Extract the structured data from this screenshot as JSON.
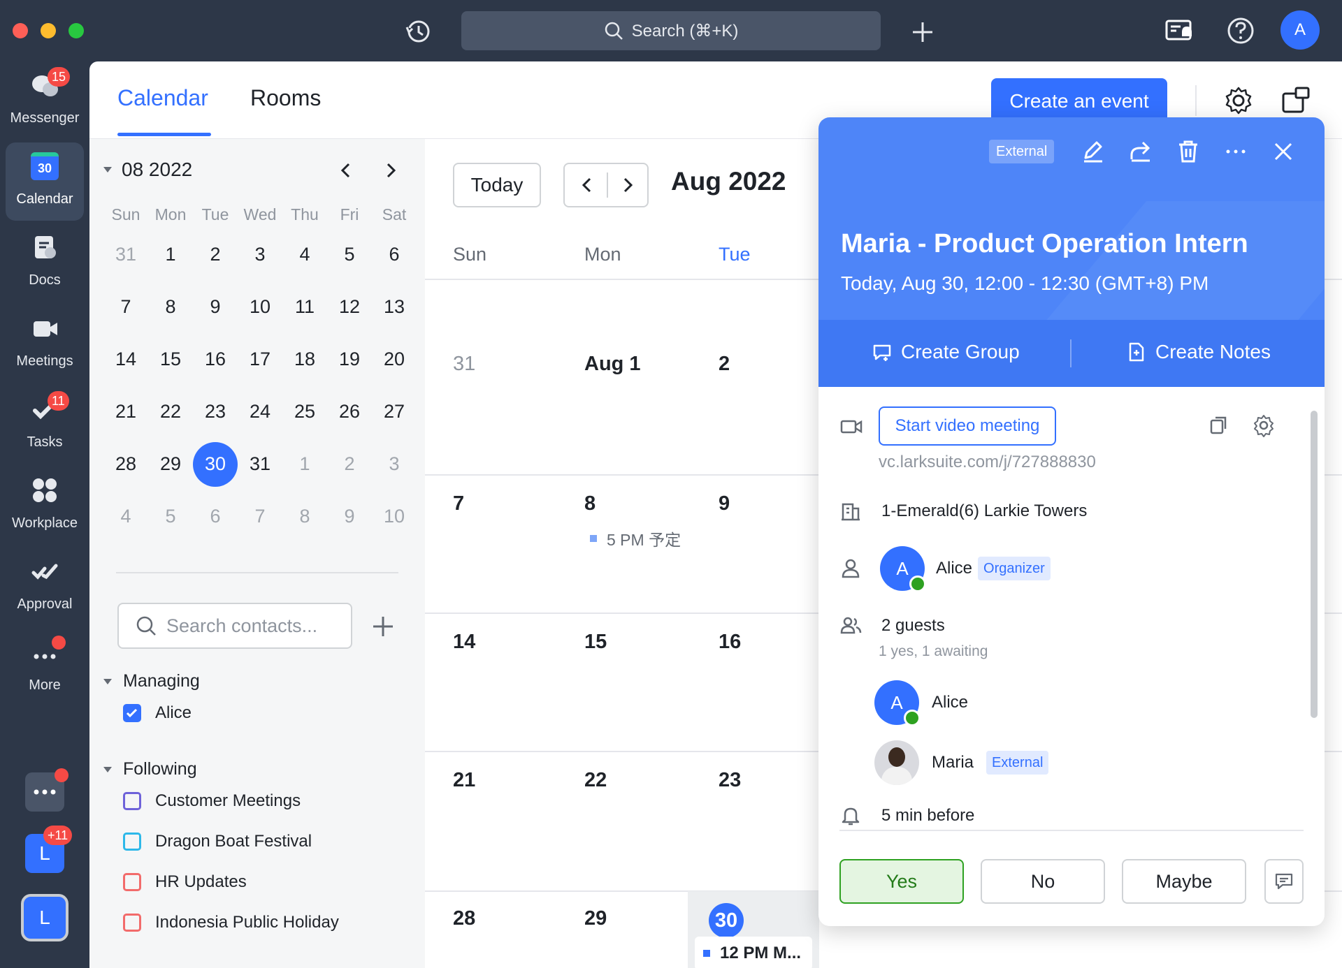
{
  "titlebar": {
    "search_label": "Search (⌘+K)",
    "avatar_initial": "A"
  },
  "nav": {
    "messenger": {
      "label": "Messenger",
      "badge": "15"
    },
    "calendar": {
      "label": "Calendar",
      "icon_day": "30"
    },
    "docs": {
      "label": "Docs"
    },
    "meetings": {
      "label": "Meetings"
    },
    "tasks": {
      "label": "Tasks",
      "badge": "11"
    },
    "workplace": {
      "label": "Workplace"
    },
    "approval": {
      "label": "Approval"
    },
    "more": {
      "label": "More"
    },
    "app_l_badge": "+11",
    "app_l_initial": "L",
    "app_l2_initial": "L"
  },
  "header": {
    "tab_calendar": "Calendar",
    "tab_rooms": "Rooms",
    "create_event": "Create an event"
  },
  "mini_calendar": {
    "title": "08 2022",
    "weekdays": [
      "Sun",
      "Mon",
      "Tue",
      "Wed",
      "Thu",
      "Fri",
      "Sat"
    ],
    "weeks": [
      [
        "31",
        "1",
        "2",
        "3",
        "4",
        "5",
        "6"
      ],
      [
        "7",
        "8",
        "9",
        "10",
        "11",
        "12",
        "13"
      ],
      [
        "14",
        "15",
        "16",
        "17",
        "18",
        "19",
        "20"
      ],
      [
        "21",
        "22",
        "23",
        "24",
        "25",
        "26",
        "27"
      ],
      [
        "28",
        "29",
        "30",
        "31",
        "1",
        "2",
        "3"
      ],
      [
        "4",
        "5",
        "6",
        "7",
        "8",
        "9",
        "10"
      ]
    ],
    "today": "30"
  },
  "sidebar": {
    "search_placeholder": "Search contacts...",
    "managing_title": "Managing",
    "managing_items": [
      "Alice"
    ],
    "following_title": "Following",
    "following_items": [
      "Customer Meetings",
      "Dragon Boat Festival",
      "HR Updates",
      "Indonesia Public Holiday"
    ],
    "colors": {
      "customer": "#6e62d9",
      "dragon": "#2db8e9",
      "hr": "#f26b6b",
      "indonesia": "#f26b6b"
    }
  },
  "calendar": {
    "today_label": "Today",
    "month_title": "Aug 2022",
    "weekdays": [
      "Sun",
      "Mon",
      "Tue"
    ],
    "rows": [
      [
        "31",
        "Aug 1",
        "2"
      ],
      [
        "7",
        "8",
        "9"
      ],
      [
        "14",
        "15",
        "16"
      ],
      [
        "21",
        "22",
        "23"
      ],
      [
        "28",
        "29",
        "30"
      ]
    ],
    "event_aug8": "5 PM 予定",
    "event_aug30": "12 PM M..."
  },
  "popup": {
    "external_chip": "External",
    "title": "Maria - Product Operation Intern",
    "time": "Today, Aug 30, 12:00 - 12:30 (GMT+8) PM",
    "create_group": "Create Group",
    "create_notes": "Create Notes",
    "start_video": "Start video meeting",
    "vc_link": "vc.larksuite.com/j/727888830",
    "room": "1-Emerald(6) Larkie Towers",
    "organizer_initial": "A",
    "organizer_name": "Alice",
    "organizer_tag": "Organizer",
    "guests_title": "2 guests",
    "guests_summary": "1 yes, 1 awaiting",
    "guest1_initial": "A",
    "guest1_name": "Alice",
    "guest2_name": "Maria",
    "guest2_tag": "External",
    "reminder": "5 min before",
    "rsvp_yes": "Yes",
    "rsvp_no": "No",
    "rsvp_maybe": "Maybe"
  }
}
